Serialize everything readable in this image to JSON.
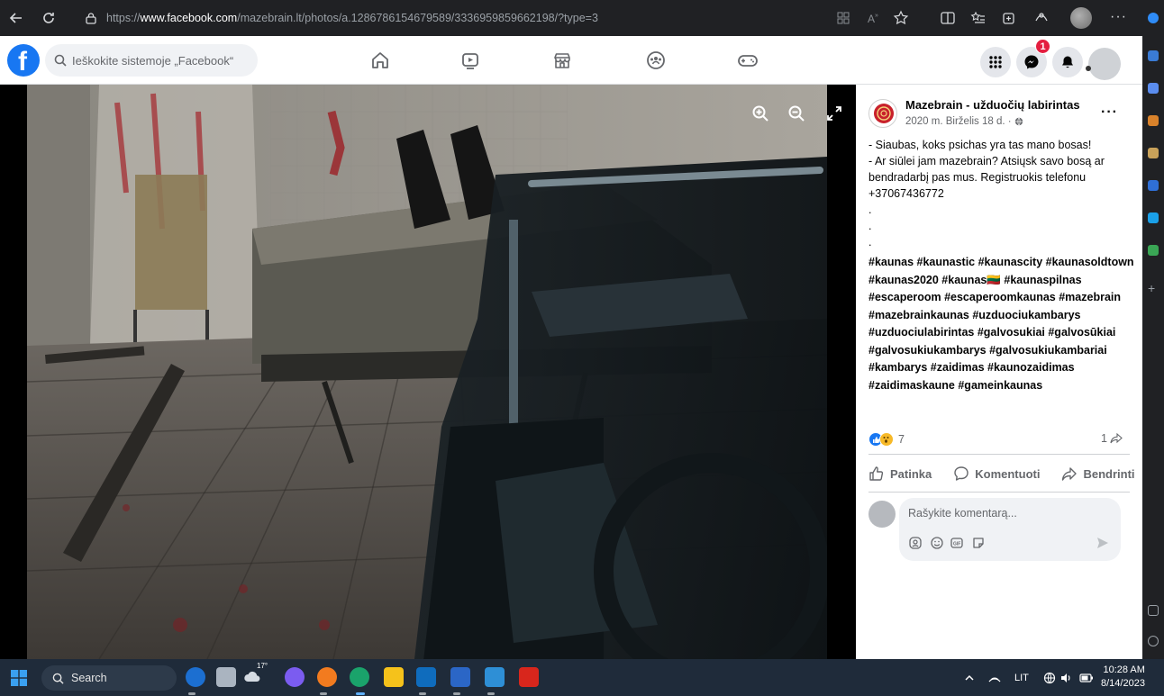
{
  "browser": {
    "url_proto": "https://",
    "url_host": "www.facebook.com",
    "url_path": "/mazebrain.lt/photos/a.1286786154679589/3336959859662198/?type=3"
  },
  "fb_nav": {
    "logo_letter": "f",
    "search_placeholder": "Ieškokite sistemoje „Facebook“",
    "messenger_badge": "1"
  },
  "post": {
    "page_name": "Mazebrain - užduočių labirintas",
    "date": "2020 m. Birželis 18 d. ·",
    "menu": "···",
    "text_lines": [
      "- Siaubas, koks psichas yra tas mano bosas!",
      "- Ar siūlei jam mazebrain? Atsiųsk savo bosą ar bendradarbį pas mus. Registruokis telefonu +37067436772",
      ".",
      ".",
      "."
    ],
    "hashtags": "#kaunas #kaunastic #kaunascity #kaunasoldtown #kaunas2020 #kaunas🇱🇹 #kaunaspilnas #escaperoom #escaperoomkaunas #mazebrain #mazebrainkaunas #uzduociukambarys #uzduociulabirintas #galvosukiai #galvosūkiai #galvosukiukambarys #galvosukiukambariai #kambarys #zaidimas #kaunozaidimas #zaidimaskaune #gameinkaunas",
    "reaction_count": "7",
    "share_count": "1",
    "actions": {
      "like": "Patinka",
      "comment": "Komentuoti",
      "share": "Bendrinti"
    },
    "comment_placeholder": "Rašykite komentarą..."
  },
  "taskbar": {
    "search_label": "Search",
    "weather_temp": "17°",
    "language": "LIT",
    "time": "10:28 AM",
    "date": "8/14/2023"
  },
  "colors": {
    "fb_blue": "#1877f2",
    "badge_red": "#e41e3f",
    "taskbar_bg": "#1f2b3a"
  }
}
